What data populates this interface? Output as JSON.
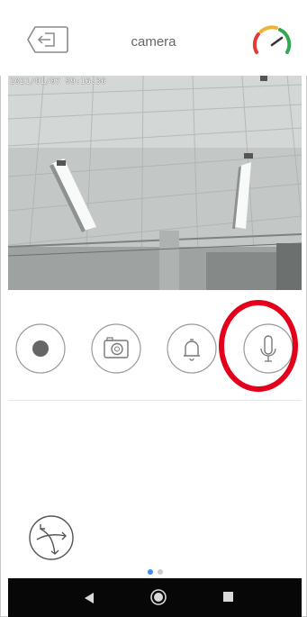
{
  "header": {
    "title": "camera",
    "back_icon": "exit-arrow-icon",
    "status_icon": "speed-gauge-icon"
  },
  "camera_feed": {
    "timestamp": "2021/01/07 09:16:36"
  },
  "controls": [
    {
      "name": "record-button",
      "icon": "record-dot-icon"
    },
    {
      "name": "snapshot-button",
      "icon": "camera-icon"
    },
    {
      "name": "alarm-button",
      "icon": "bell-icon"
    },
    {
      "name": "microphone-button",
      "icon": "microphone-icon",
      "highlight_color": "#e4001b"
    }
  ],
  "ptz_button": {
    "icon": "ptz-direction-icon"
  },
  "pager": {
    "pages": 2,
    "active_index": 0,
    "active_color": "#3c8ee8",
    "inactive_color": "#cccccc"
  },
  "android_nav": [
    "back-triangle-icon",
    "home-circle-icon",
    "recents-square-icon"
  ],
  "colors": {
    "icon_gray": "#8a8a8a",
    "gauge_green": "#2fa84f",
    "gauge_yellow": "#f2b233",
    "gauge_red": "#e53935",
    "highlight_ring": "#e4001b"
  }
}
